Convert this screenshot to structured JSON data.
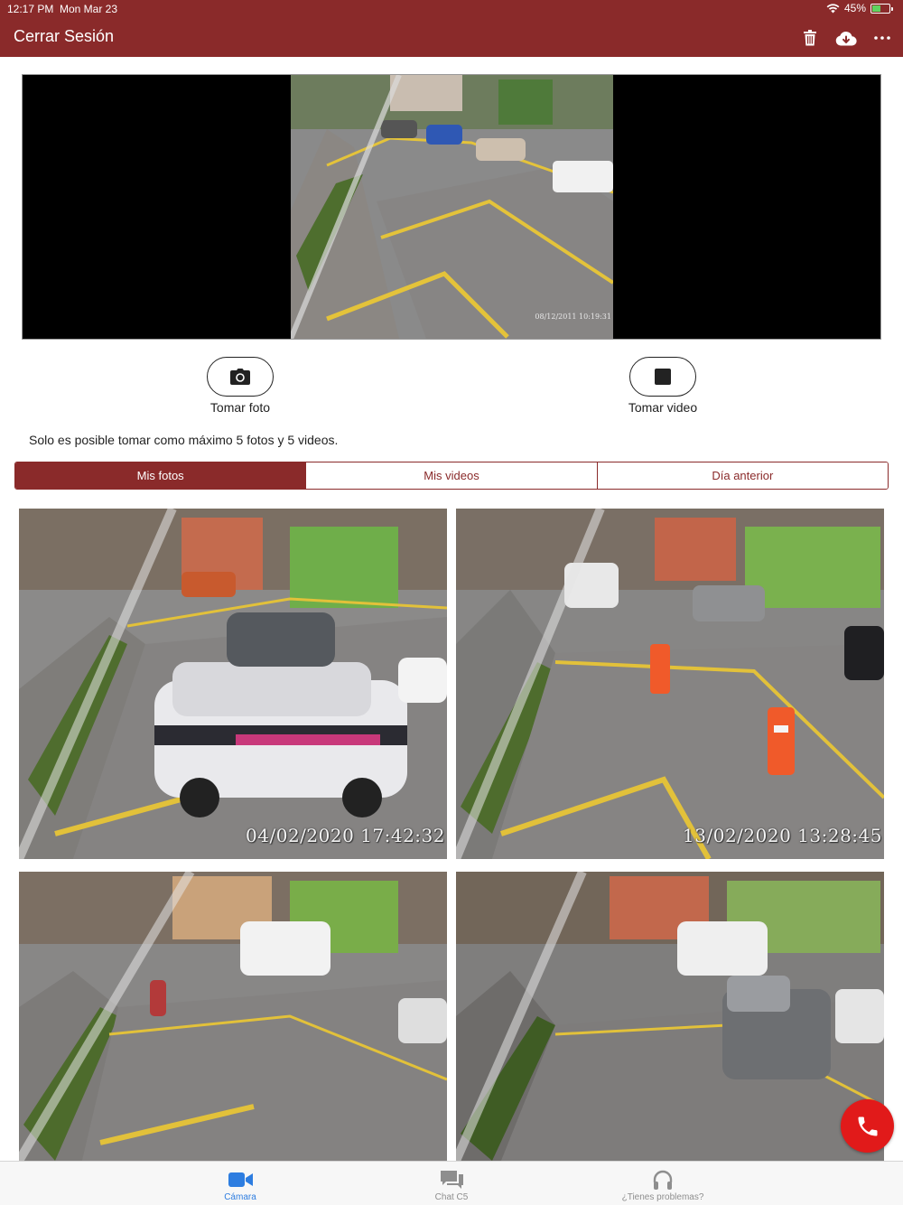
{
  "status_bar": {
    "time": "12:17 PM",
    "date": "Mon Mar 23",
    "battery": "45%",
    "battery_level": 0.45
  },
  "header": {
    "logout_label": "Cerrar Sesión",
    "icons": [
      "trash-icon",
      "cloud-download-icon",
      "more-icon"
    ]
  },
  "video": {
    "timestamp": "08/12/2011 10:19:31"
  },
  "controls": {
    "photo_label": "Tomar foto",
    "video_label": "Tomar video"
  },
  "note": "Solo es posible tomar como máximo 5 fotos y 5 videos.",
  "tabs": [
    {
      "label": "Mis fotos",
      "active": true
    },
    {
      "label": "Mis videos",
      "active": false
    },
    {
      "label": "Día anterior",
      "active": false
    }
  ],
  "photos": [
    {
      "timestamp": "04/02/2020 17:42:32"
    },
    {
      "timestamp": "13/02/2020 13:28:45"
    },
    {
      "timestamp": ""
    },
    {
      "timestamp": ""
    }
  ],
  "bottom_nav": [
    {
      "label": "Cámara",
      "icon": "video-camera-icon",
      "active": true
    },
    {
      "label": "Chat C5",
      "icon": "chat-icon",
      "active": false
    },
    {
      "label": "¿Tienes problemas?",
      "icon": "headphones-icon",
      "active": false
    }
  ],
  "colors": {
    "brand": "#8a2a2a",
    "accent": "#2d7de0",
    "call": "#e11a1a"
  }
}
